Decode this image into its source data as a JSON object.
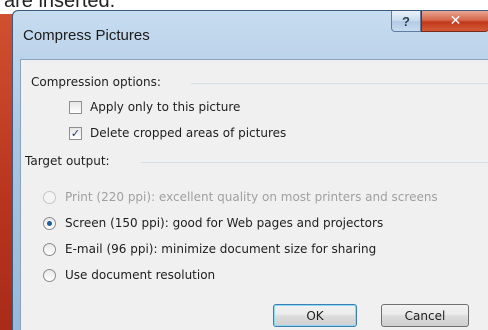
{
  "background": {
    "partial_text": "are inserted."
  },
  "dialog": {
    "title": "Compress Pictures",
    "help_glyph": "?",
    "close_glyph": "✕",
    "compression": {
      "group_label": "Compression options:",
      "apply_only": {
        "label": "Apply only to this picture",
        "checked": false
      },
      "delete_cropped": {
        "label": "Delete cropped areas of pictures",
        "checked": true,
        "check_glyph": "✓"
      }
    },
    "target": {
      "group_label": "Target output:",
      "options": [
        {
          "label": "Print (220 ppi): excellent quality on most printers and screens",
          "selected": false,
          "enabled": false
        },
        {
          "label": "Screen (150 ppi): good for Web pages and projectors",
          "selected": true,
          "enabled": true
        },
        {
          "label": "E-mail (96 ppi): minimize document size for sharing",
          "selected": false,
          "enabled": true
        },
        {
          "label": "Use document resolution",
          "selected": false,
          "enabled": true
        }
      ]
    },
    "buttons": {
      "ok": "OK",
      "cancel": "Cancel"
    }
  },
  "colors": {
    "frame": "#a9c6e2",
    "close": "#c0391a",
    "radio_dot": "#1d5f9a"
  }
}
